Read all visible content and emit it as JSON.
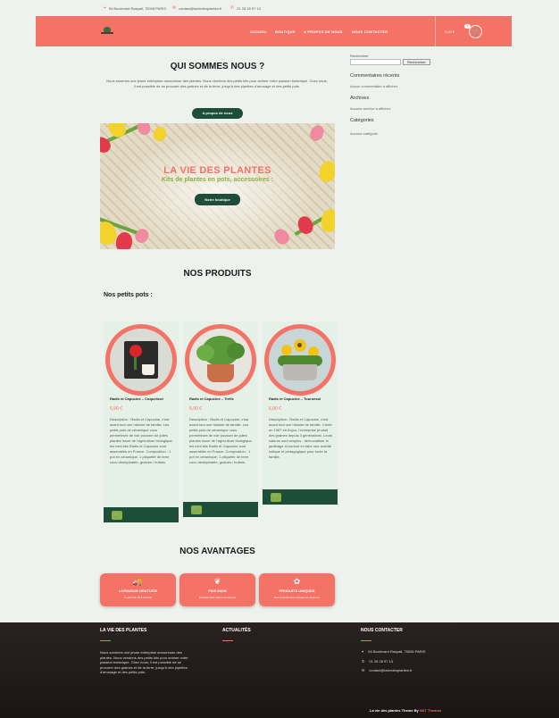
{
  "topbar": {
    "address": "54 Boulevard Raspail, 75006 PARIS",
    "email": "contact@laviedesplantes.fr",
    "phone": "01 28 28 97 13"
  },
  "nav": [
    "ACCUEIL",
    "BOUTIQUE",
    "A PROPOS DE NOUS",
    "NOUS CONTACTER"
  ],
  "cart": {
    "amount": "0,00 €",
    "count": "0"
  },
  "about": {
    "title": "QUI SOMMES NOUS ?",
    "text": "Nous sommes une jeune entreprise amoureuse des plantes. Nous vendons des petits kits pour animer votre passion botanique. Chez nous, il est possible de se procurer des graines et de la terre, jusqu'à des pipettes d'arrosage et des petits pots.",
    "button": "A propos de nous"
  },
  "banner": {
    "title": "LA VIE DES PLANTES",
    "subtitle": "Kits de plantes en pots, accessoires :",
    "button": "Notre boutique"
  },
  "products": {
    "title": "NOS PRODUITS",
    "subtitle": "Nos petits pots :",
    "items": [
      {
        "name": "Radis et Capucine – Coquelicot",
        "price": "6,90 €",
        "description": "Description : Radis et Capucine, c'est avant tout une histoire de famille. Les petits pots de céramique vous permettront de voir pousser de jolies plantes issue de l'agriculture biologique. les mini kits Radis et Capucine sont assemblés en France. Composition : 1 pot en céramique, 1 pliquette de terre coco déshydratée, graines / bulbes."
      },
      {
        "name": "Radis et Capucine – Trèfle",
        "price": "6,90 €",
        "description": "Description : Radis et Capucine, c'est avant tout une histoire de famille. Les petits pots de céramique vous permettront de voir pousser de jolies plantes issue de l'agriculture biologique. les mini kits Radis et Capucine sont assemblés en France. Composition : 1 pot en céramique, 1 pliquette de terre coco déshydratée, graines / bulbes."
      },
      {
        "name": "Radis et Capucine – Tournesol",
        "price": "6,90 €",
        "description": "Description : Radis et Capucine, c'est avant tout une histoire de famille. Créée en 1987 en Anjou, l'entreprise produit des graines depuis 3 générations. Leurs valeurs sont simples : démocratiser le jardinage et surtout en faire une activité ludique et pédagogique pour toute la famille."
      }
    ]
  },
  "advantages": {
    "title": "NOS AVANTAGES",
    "items": [
      {
        "icon": "truck-icon",
        "title": "LIVRAISON GRATUITE",
        "text": "À partir de 50 € d'achat"
      },
      {
        "icon": "hands-leaf-icon",
        "title": "FAIS MAIN",
        "text": "Produits faits mains et naturels"
      },
      {
        "icon": "flower-icon",
        "title": "PRODUITS UNIQUES",
        "text": "Des produits tous uniques et originaux"
      }
    ]
  },
  "sidebar": {
    "search_label": "Rechercher",
    "search_button": "Rechercher",
    "recent_comments_title": "Commentaires récents",
    "recent_comments_text": "Aucun commentaire à afficher.",
    "archives_title": "Archives",
    "archives_text": "Aucune archive à afficher.",
    "categories_title": "Catégories",
    "categories_text": "Aucune catégorie"
  },
  "footer": {
    "col1_title": "LA VIE DES PLANTES",
    "col1_text": "Nous sommes une jeune entreprise amoureuse des plantes. Nous vendons des petits kits pour animer votre passion botanique. Chez nous, il est possible de se procurer des graines et de la terre, jusqu'à des pipettes d'arrosage et des petits pots.",
    "col2_title": "ACTUALITÉS",
    "col3_title": "NOUS CONTACTER",
    "address": "54 Boulevard Raspail, 75006 PARIS",
    "phone": "01 28 28 97 13",
    "email": "contact@laviedesplantes.fr",
    "copyright_prefix": "La vie des plantes Theme By ",
    "copyright_link": "SKT Themes"
  },
  "colors": {
    "accent": "#f47266",
    "dark_green": "#1e4d3a",
    "light_green": "#8ab041"
  }
}
